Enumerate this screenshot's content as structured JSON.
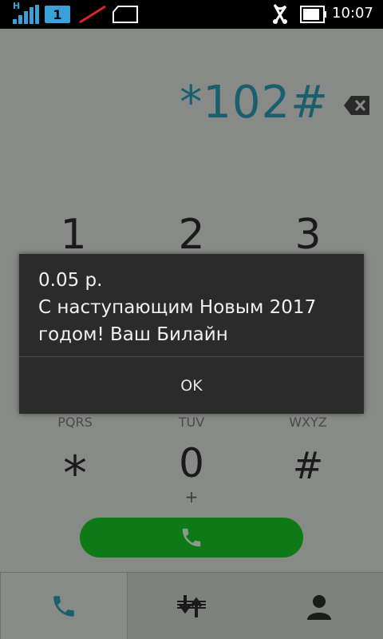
{
  "status": {
    "network_type": "H",
    "sim_slot": "1",
    "time": "10:07"
  },
  "dialer": {
    "number": "*102#",
    "keys_top": [
      {
        "digit": "1"
      },
      {
        "digit": "2"
      },
      {
        "digit": "3"
      }
    ],
    "letters_bottom": [
      "PQRS",
      "TUV",
      "WXYZ"
    ],
    "bottom_keys": [
      "*",
      "0",
      "#"
    ],
    "zero_sub": "+"
  },
  "dialog": {
    "line1": "0.05 р.",
    "line2": "С наступающим Новым 2017",
    "line3": "годом! Ваш Билайн",
    "ok_label": "OK"
  },
  "icons": {
    "backspace": "backspace-icon",
    "call": "phone-icon",
    "tab_phone": "phone-icon",
    "tab_calllog": "call-log-icon",
    "tab_contacts": "contact-icon"
  },
  "colors": {
    "accent": "#3aa0d8",
    "call_green": "#0e7a17",
    "number": "#1a5f6e"
  }
}
